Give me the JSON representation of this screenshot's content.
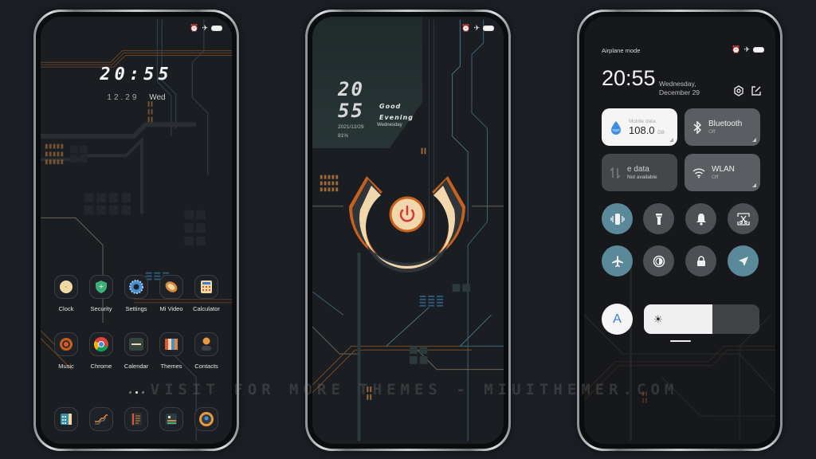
{
  "phones": {
    "home": {
      "status_icons": [
        "alarm-icon",
        "airplane-icon",
        "battery-icon"
      ],
      "clock": "20:55",
      "date": "12.29",
      "weekday": "Wed",
      "apps_row1": [
        {
          "label": "Clock",
          "icon": "clock-icon"
        },
        {
          "label": "Security",
          "icon": "shield-icon"
        },
        {
          "label": "Settings",
          "icon": "gear-icon"
        },
        {
          "label": "Mi Video",
          "icon": "video-icon"
        },
        {
          "label": "Calculator",
          "icon": "calculator-icon"
        }
      ],
      "apps_row2": [
        {
          "label": "Music",
          "icon": "music-icon"
        },
        {
          "label": "Chrome",
          "icon": "chrome-icon"
        },
        {
          "label": "Calendar",
          "icon": "calendar-icon"
        },
        {
          "label": "Themes",
          "icon": "themes-icon"
        },
        {
          "label": "Contacts",
          "icon": "contacts-icon"
        }
      ],
      "page_indicator": {
        "count": 3,
        "active": 1
      },
      "dock": [
        {
          "icon": "phone-keypad-icon"
        },
        {
          "icon": "messages-icon"
        },
        {
          "icon": "notes-icon"
        },
        {
          "icon": "gallery-icon"
        },
        {
          "icon": "camera-icon"
        }
      ]
    },
    "lock": {
      "status_icons": [
        "alarm-icon",
        "airplane-icon",
        "battery-icon"
      ],
      "clock_hours": "20",
      "clock_minutes": "55",
      "greeting_line1": "Good",
      "greeting_line2": "Evening",
      "weekday": "Wednesday",
      "date": "2021/12/29",
      "battery": "81%",
      "center_icon": "power-icon"
    },
    "control_center": {
      "mode_label": "Airplane mode",
      "status_icons": [
        "alarm-icon",
        "airplane-icon",
        "battery-icon"
      ],
      "time": "20:55",
      "date_line1": "Wednesday,",
      "date_line2": "December 29",
      "tiles": [
        {
          "title": "Mobile data",
          "value": "108.0",
          "unit": "GB",
          "icon": "water-drop-icon",
          "state": "on"
        },
        {
          "title": "Bluetooth",
          "sub": "Off",
          "icon": "bluetooth-icon",
          "state": "off"
        },
        {
          "title": "e data",
          "sub": "Not available",
          "icon": "data-transfer-icon",
          "state": "unavailable"
        },
        {
          "title": "WLAN",
          "sub": "Off",
          "icon": "wifi-icon",
          "state": "off"
        }
      ],
      "toggles_row1": [
        {
          "name": "vibrate",
          "icon": "vibrate-icon",
          "active": true
        },
        {
          "name": "flashlight",
          "icon": "flashlight-icon",
          "active": false
        },
        {
          "name": "mute",
          "icon": "bell-icon",
          "active": false
        },
        {
          "name": "screenshot",
          "icon": "screenshot-icon",
          "active": false
        }
      ],
      "toggles_row2": [
        {
          "name": "airplane",
          "icon": "airplane-icon",
          "active": true
        },
        {
          "name": "reading-mode",
          "icon": "contrast-icon",
          "active": false
        },
        {
          "name": "lock-screen",
          "icon": "lock-icon",
          "active": false
        },
        {
          "name": "location",
          "icon": "location-arrow-icon",
          "active": true
        }
      ],
      "auto_brightness_label": "A",
      "brightness_percent": 59
    }
  },
  "watermark": "VISIT FOR MORE THEMES - MIUITHEMER.COM",
  "colors": {
    "accent_orange": "#c8611c",
    "ring_cream": "#f2d7ac",
    "active_toggle": "#5a8a99",
    "power_red": "#d23b2f"
  }
}
